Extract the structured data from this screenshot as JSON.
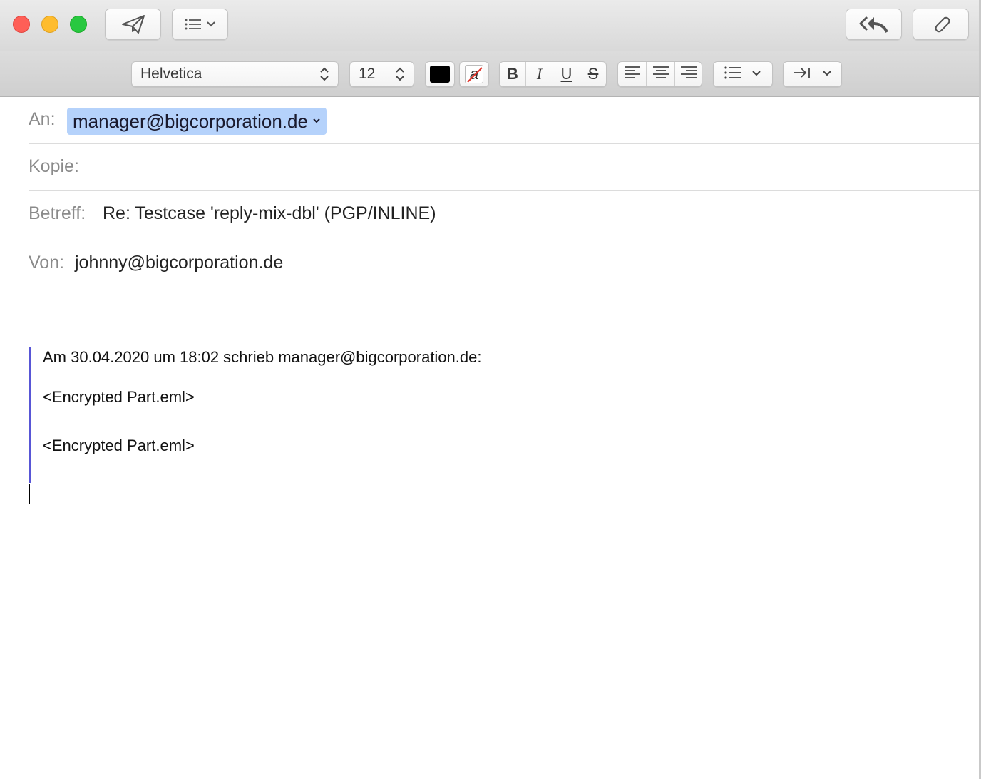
{
  "toolbar": {
    "send_icon": "paper-plane-icon",
    "header_fields_icon": "list-icon",
    "reply_all_icon": "reply-all-icon",
    "attach_icon": "paperclip-icon"
  },
  "format_bar": {
    "font_family": "Helvetica",
    "font_size": "12",
    "text_color": "#000000",
    "bold_label": "B",
    "italic_label": "I",
    "underline_label": "U",
    "strike_label": "S",
    "background_color_label": "a"
  },
  "header": {
    "to_label": "An:",
    "to_value": "manager@bigcorporation.de",
    "cc_label": "Kopie:",
    "cc_value": "",
    "subject_label": "Betreff:",
    "subject_value": "Re: Testcase 'reply-mix-dbl' (PGP/INLINE)",
    "from_label": "Von:",
    "from_value": "johnny@bigcorporation.de"
  },
  "body": {
    "quote_intro": "Am 30.04.2020 um 18:02 schrieb manager@bigcorporation.de:",
    "attachments": [
      "<Encrypted Part.eml>",
      "<Encrypted Part.eml>"
    ]
  },
  "colors": {
    "quote_bar": "#5856d6",
    "token_bg": "#b5d2fb"
  }
}
